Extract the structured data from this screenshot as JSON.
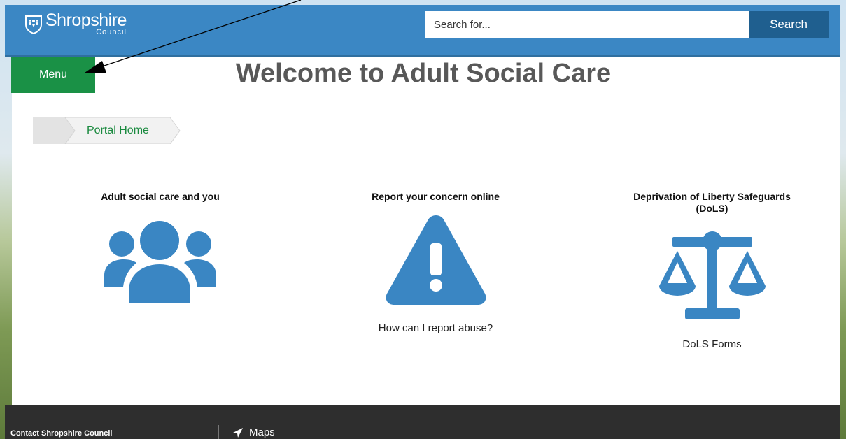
{
  "header": {
    "logo_name": "Shropshire",
    "logo_sub": "Council",
    "search_placeholder": "Search for...",
    "search_button_label": "Search"
  },
  "nav": {
    "menu_label": "Menu"
  },
  "page": {
    "title": "Welcome to Adult Social Care"
  },
  "breadcrumb": {
    "home_label": "Portal Home"
  },
  "tiles": [
    {
      "title": "Adult social care and you",
      "icon": "users-group-icon",
      "link": ""
    },
    {
      "title": "Report your concern online",
      "icon": "warning-triangle-icon",
      "link": "How can I report abuse?"
    },
    {
      "title": "Deprivation of Liberty Safeguards (DoLS)",
      "icon": "scales-icon",
      "link": "DoLS Forms"
    }
  ],
  "footer": {
    "contact_label": "Contact Shropshire Council",
    "maps_label": "Maps"
  },
  "colors": {
    "header_blue": "#3b87c4",
    "search_button": "#1f5f8f",
    "menu_green": "#1a9146",
    "icon_blue": "#3a86c3",
    "footer_dark": "#2e2e2e"
  }
}
